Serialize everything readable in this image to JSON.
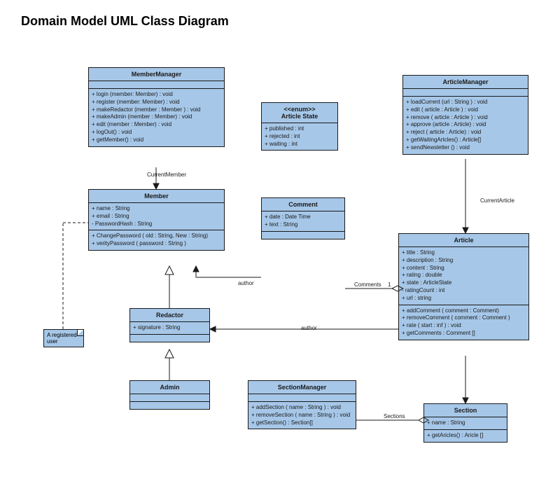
{
  "title": "Domain Model UML Class Diagram",
  "classes": {
    "memberManager": {
      "name": "MemberManager",
      "ops": [
        "+  login (member: Member) : void",
        "+  register (member:  Member) : void",
        "+ makeRedactor (member : Member ) : void",
        "+ makeAdmin (member : Member) : void",
        "+ edit (member : Member) : void",
        "+ logOut() : void",
        "+ getMember() : void"
      ]
    },
    "articleState": {
      "stereotype": "<<enum>>",
      "name": "Article State",
      "attrs": [
        "+  published : int",
        "+  rejected : int",
        "+  waiting : int"
      ]
    },
    "articleManager": {
      "name": "ArticleManager",
      "ops": [
        "+ loadCurrent (url : String ) : void",
        "+ edit ( article : Article ) : void",
        "+ remove ( article : Article ) : void",
        "+ approve (article : Article) : void",
        "+ reject ( article : Article) : void",
        "+ getWaitingArtcles() : Article[]",
        "+ sendNewsletter () : void"
      ]
    },
    "member": {
      "name": "Member",
      "attrs": [
        "+ name : String",
        "+ email : String",
        "-  PasswordHash : String"
      ],
      "ops": [
        "+  ChangePassword ( old : String, New : String)",
        "+  verityPassword ( password : String )"
      ]
    },
    "comment": {
      "name": "Comment",
      "attrs": [
        "+  date : Date Time",
        "+  text : String"
      ]
    },
    "redactor": {
      "name": "Redactor",
      "attrs": [
        "+ signature : String"
      ]
    },
    "admin": {
      "name": "Admin"
    },
    "sectionManager": {
      "name": "SectionManager",
      "ops": [
        "+ addSection ( name : String ) : void",
        "+ removeSection ( name : String ) : void",
        "+ getSection() : Section[]"
      ]
    },
    "article": {
      "name": "Article",
      "attrs": [
        "+ title : String",
        "+ description : String",
        "+ content : String",
        "+ rating : double",
        "+ state : ArticleState",
        "-  ratingCount : int",
        "+ url : string"
      ],
      "ops": [
        "+ addComment ( comment : Comment)",
        "+ removeComment ( comment : Comment )",
        "+ rate ( start : inf ) : void",
        "+ getComments : Comment []"
      ]
    },
    "section": {
      "name": "Section",
      "attrs": [
        "+ name : String"
      ],
      "ops": [
        "+ getAricles() : Aricle []"
      ]
    }
  },
  "note": "A registered user",
  "labels": {
    "currentMember": "CurrentMember",
    "currentArticle": "CurrentArticle",
    "author1": "author",
    "author2": "author",
    "comments": "Comments",
    "commentsMult": "1",
    "sections": "Sections"
  }
}
